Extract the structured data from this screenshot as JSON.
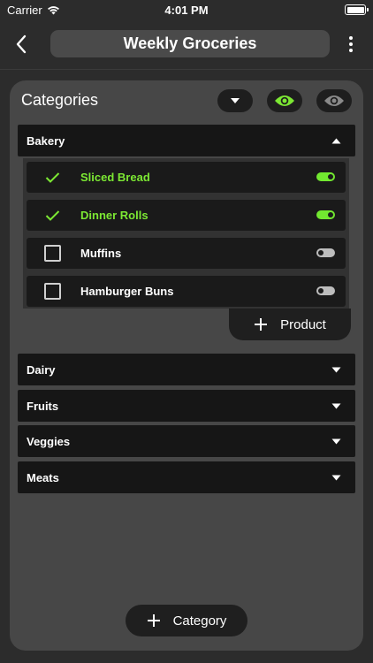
{
  "status_bar": {
    "carrier": "Carrier",
    "time": "4:01 PM"
  },
  "nav": {
    "title": "Weekly Groceries"
  },
  "panel": {
    "title": "Categories"
  },
  "categories": [
    {
      "name": "Bakery",
      "expanded": true
    },
    {
      "name": "Dairy",
      "expanded": false
    },
    {
      "name": "Fruits",
      "expanded": false
    },
    {
      "name": "Veggies",
      "expanded": false
    },
    {
      "name": "Meats",
      "expanded": false
    }
  ],
  "products": [
    {
      "name": "Sliced Bread",
      "checked": true,
      "toggle": "on"
    },
    {
      "name": "Dinner Rolls",
      "checked": true,
      "toggle": "on"
    },
    {
      "name": "Muffins",
      "checked": false,
      "toggle": "off"
    },
    {
      "name": "Hamburger Buns",
      "checked": false,
      "toggle": "off"
    }
  ],
  "buttons": {
    "add_product": "Product",
    "add_category": "Category"
  },
  "colors": {
    "accent": "#7ce833",
    "background": "#2c2c2c",
    "card": "#474747",
    "row": "#161616"
  },
  "icons": [
    "wifi-icon",
    "battery-icon",
    "chevron-left-icon",
    "ellipsis-vertical-icon",
    "caret-down-icon",
    "eye-icon",
    "caret-up-icon",
    "checkmark-icon",
    "plus-icon"
  ]
}
